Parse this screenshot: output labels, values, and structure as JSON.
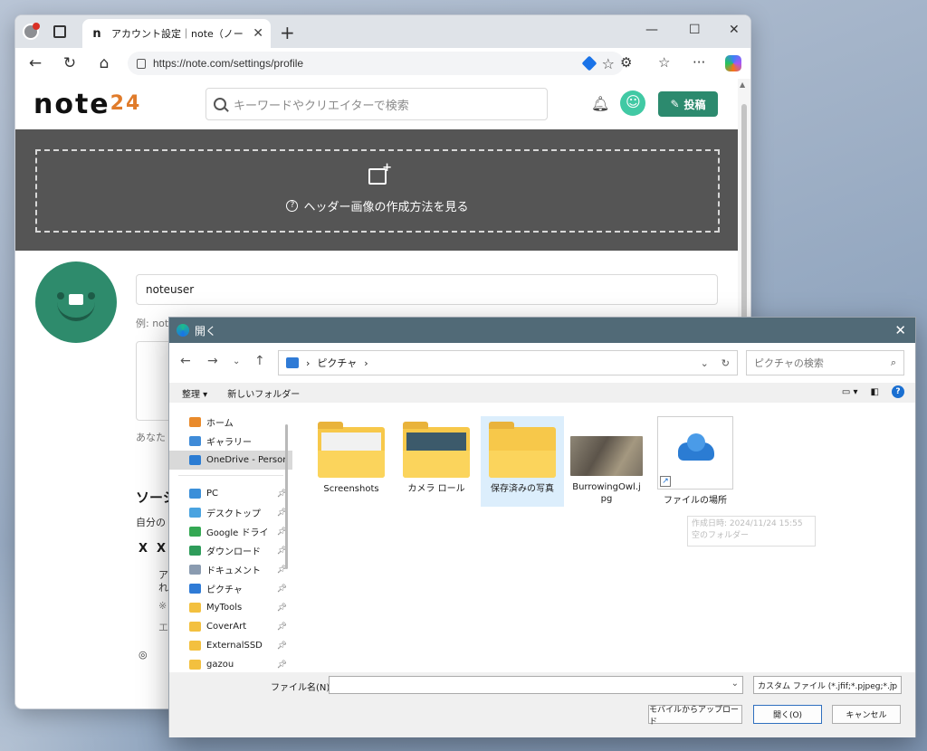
{
  "browser": {
    "tab_title": "アカウント設定｜note（ノート）",
    "tab_favicon": "n",
    "url": "https://note.com/settings/profile"
  },
  "note": {
    "logo": "note",
    "logo_24": "24",
    "search_placeholder": "キーワードやクリエイターで検索",
    "post_label": "投稿",
    "header_link": "ヘッダー画像の作成方法を見る",
    "name_value": "noteuser",
    "example_text": "例: note太郎",
    "bio_note": "あなた",
    "social_heading": "ソーシ",
    "social_sub": "自分の",
    "x_label": "X",
    "x_bold": "X",
    "snip1": "ア",
    "snip2": "れ",
    "snip3": "※",
    "snip4": "エ"
  },
  "dialog": {
    "title": "開く",
    "breadcrumb": "ピクチャ",
    "search_placeholder": "ピクチャの検索",
    "organize": "整理",
    "new_folder": "新しいフォルダー",
    "nav": [
      {
        "label": "ホーム",
        "color": "#e98a2b",
        "pinned": false
      },
      {
        "label": "ギャラリー",
        "color": "#3f8bd8",
        "pinned": false
      },
      {
        "label": "OneDrive - Persor",
        "color": "#2b7cd3",
        "pinned": false,
        "selected": true
      },
      {
        "label": "PC",
        "color": "#3b8fd9",
        "pinned": true
      },
      {
        "label": "デスクトップ",
        "color": "#4aa3e0",
        "pinned": true
      },
      {
        "label": "Google ドライ",
        "color": "#34a853",
        "pinned": true
      },
      {
        "label": "ダウンロード",
        "color": "#2e9c5a",
        "pinned": true
      },
      {
        "label": "ドキュメント",
        "color": "#8a9bb0",
        "pinned": true
      },
      {
        "label": "ピクチャ",
        "color": "#2f7bd6",
        "pinned": true
      },
      {
        "label": "MyTools",
        "color": "#f3c03f",
        "pinned": true
      },
      {
        "label": "CoverArt",
        "color": "#f3c03f",
        "pinned": true
      },
      {
        "label": "ExternalSSD",
        "color": "#f3c03f",
        "pinned": true
      },
      {
        "label": "gazou",
        "color": "#f3c03f",
        "pinned": true
      }
    ],
    "files": [
      {
        "label": "Screenshots",
        "kind": "folder"
      },
      {
        "label": "カメラ ロール",
        "kind": "folder"
      },
      {
        "label": "保存済みの写真",
        "kind": "folder"
      },
      {
        "label": "BurrowingOwl.jpg",
        "kind": "image"
      },
      {
        "label": "ファイルの場所",
        "kind": "shortcut"
      }
    ],
    "tooltip_line1": "作成日時: 2024/11/24 15:55",
    "tooltip_line2": "空のフォルダー",
    "filename_label": "ファイル名(N):",
    "filename_value": "",
    "filetype": "カスタム ファイル (*.jfif;*.pjpeg;*.jp",
    "upload_mobile": "モバイルからアップロード",
    "open_btn": "開く(O)",
    "cancel_btn": "キャンセル"
  }
}
